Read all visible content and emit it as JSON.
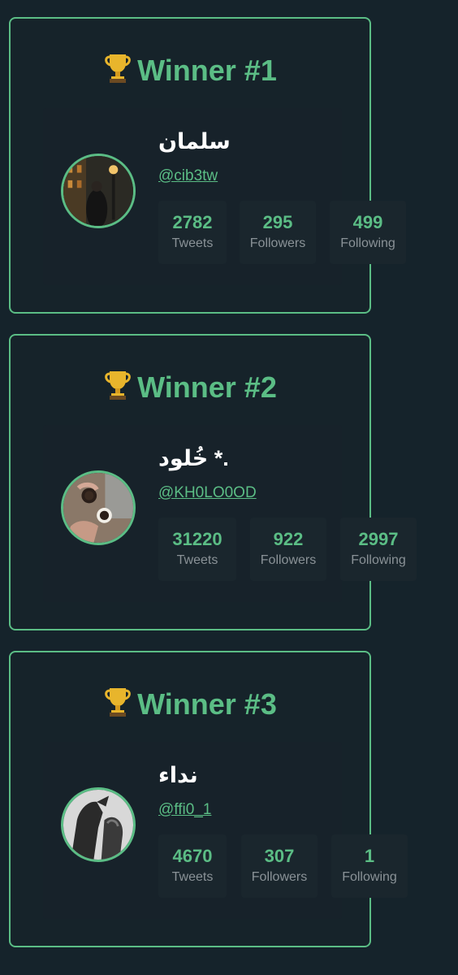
{
  "colors": {
    "accent": "#5bbd85",
    "background": "#15232b",
    "card": "#17222a",
    "stat_box": "#1a262d",
    "muted": "#8a9297"
  },
  "winners": [
    {
      "title": "Winner #1",
      "trophy_icon": "trophy-icon",
      "name": "سلمان",
      "handle": "@cib3tw",
      "stats": [
        {
          "value": "2782",
          "label": "Tweets"
        },
        {
          "value": "295",
          "label": "Followers"
        },
        {
          "value": "499",
          "label": "Following"
        }
      ]
    },
    {
      "title": "Winner #2",
      "trophy_icon": "trophy-icon",
      "name": ".* خُلود",
      "handle": "@KH0LO0OD",
      "stats": [
        {
          "value": "31220",
          "label": "Tweets"
        },
        {
          "value": "922",
          "label": "Followers"
        },
        {
          "value": "2997",
          "label": "Following"
        }
      ]
    },
    {
      "title": "Winner #3",
      "trophy_icon": "trophy-icon",
      "name": "نداء",
      "handle": "@ffi0_1",
      "stats": [
        {
          "value": "4670",
          "label": "Tweets"
        },
        {
          "value": "307",
          "label": "Followers"
        },
        {
          "value": "1",
          "label": "Following"
        }
      ]
    }
  ]
}
